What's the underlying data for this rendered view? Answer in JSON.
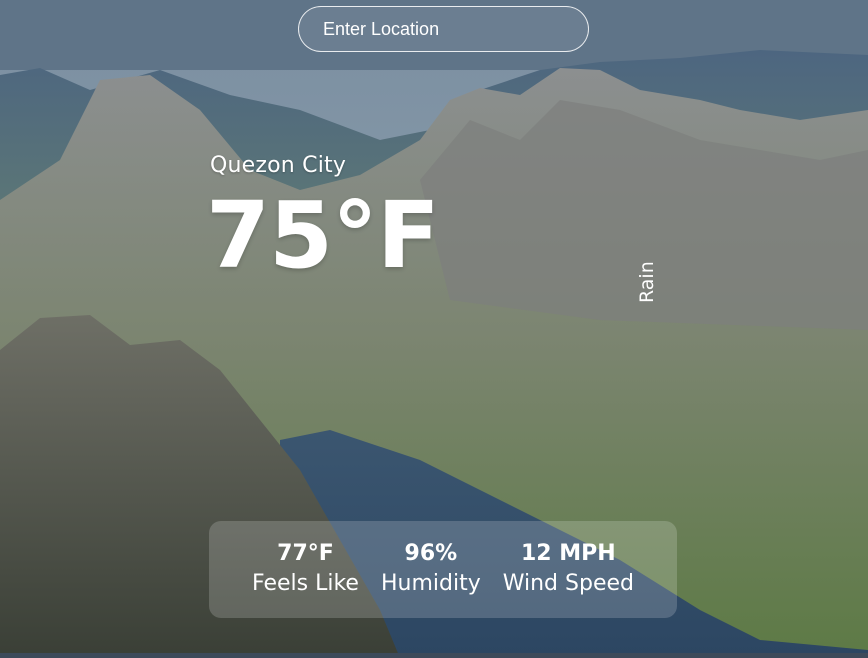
{
  "search": {
    "placeholder": "Enter Location"
  },
  "weather": {
    "city": "Quezon City",
    "temperature": "75°F",
    "condition": "Rain"
  },
  "stats": [
    {
      "value": "77°F",
      "label": "Feels Like"
    },
    {
      "value": "96%",
      "label": "Humidity"
    },
    {
      "value": "12 MPH",
      "label": "Wind Speed"
    }
  ]
}
